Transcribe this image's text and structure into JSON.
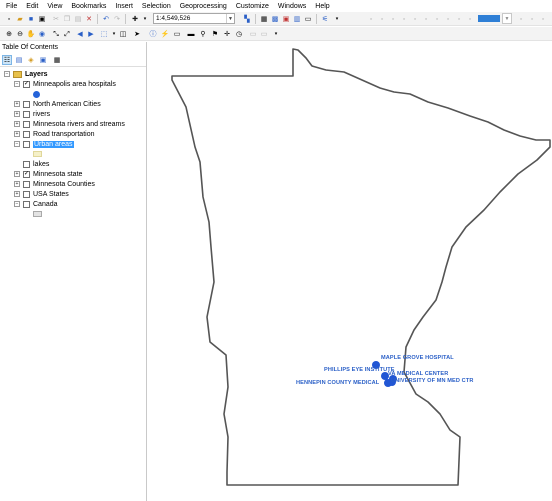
{
  "menu": [
    "File",
    "Edit",
    "View",
    "Bookmarks",
    "Insert",
    "Selection",
    "Geoprocessing",
    "Customize",
    "Windows",
    "Help"
  ],
  "toolbar": {
    "scale_value": "1:4,549,526"
  },
  "toc": {
    "title": "Table Of Contents",
    "root": "Layers",
    "layers": [
      {
        "label": "Minneapolis area hospitals",
        "checked": true,
        "expanded": true
      },
      {
        "label": "North American Cities",
        "checked": false,
        "expanded": false
      },
      {
        "label": "rivers",
        "checked": false,
        "expanded": false
      },
      {
        "label": "Minnesota rivers and streams",
        "checked": false,
        "expanded": false
      },
      {
        "label": "Road transportation",
        "checked": false,
        "expanded": false
      },
      {
        "label": "Urban areas",
        "checked": false,
        "expanded": true,
        "selected": true
      },
      {
        "label": "lakes",
        "checked": false,
        "expanded": false
      },
      {
        "label": "Minnesota state",
        "checked": true,
        "expanded": false
      },
      {
        "label": "Minnesota Counties",
        "checked": false,
        "expanded": false
      },
      {
        "label": "USA States",
        "checked": false,
        "expanded": false
      },
      {
        "label": "Canada",
        "checked": false,
        "expanded": true
      }
    ]
  },
  "map": {
    "hospitals": [
      "MAPLE GROVE HOSPITAL",
      "PHILLIPS EYE INSTITUTE",
      "VA MEDICAL CENTER",
      "HENNEPIN COUNTY MEDICAL",
      "UNIVERSITY OF MN MED CTR"
    ],
    "label_color": "#2a5fc7",
    "point_color": "#2156d4",
    "outline_color": "#555555"
  }
}
